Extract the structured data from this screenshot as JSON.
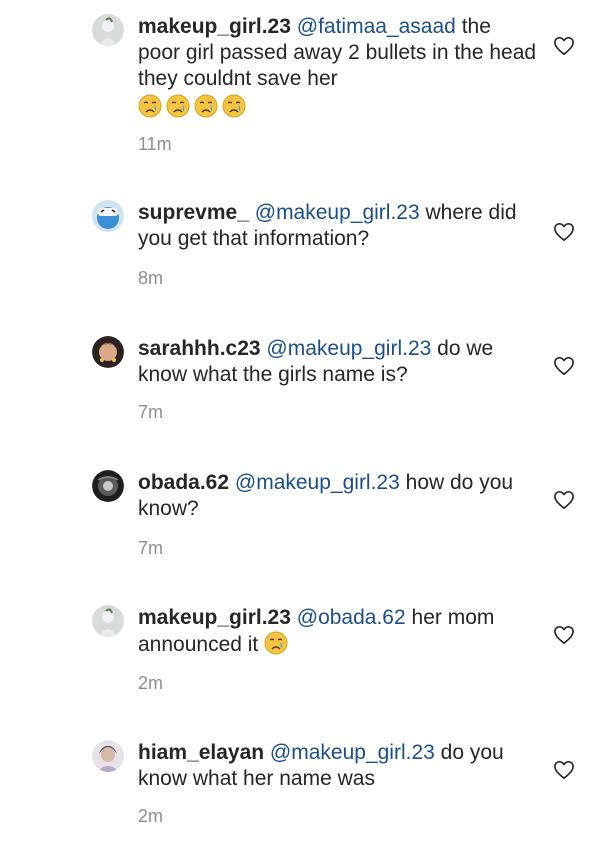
{
  "comments": [
    {
      "username": "makeup_girl.23",
      "mention": "@fatimaa_asaad",
      "text": "the poor girl passed away 2 bullets in the head they couldnt save her",
      "emoji": [
        "crying-face",
        "crying-face",
        "crying-face",
        "crying-face"
      ],
      "time": "11m"
    },
    {
      "username": "suprevme_",
      "mention": "@makeup_girl.23",
      "text": "where did you get that information?",
      "time": "8m"
    },
    {
      "username": "sarahhh.c23",
      "mention": "@makeup_girl.23",
      "text": "do we know what the girls name is?",
      "time": "7m"
    },
    {
      "username": "obada.62",
      "mention": "@makeup_girl.23",
      "text": "how do you know?",
      "time": "7m"
    },
    {
      "username": "makeup_girl.23",
      "mention": "@obada.62",
      "text": "her mom announced it",
      "emoji": [
        "crying-face"
      ],
      "time": "2m"
    },
    {
      "username": "hiam_elayan",
      "mention": "@makeup_girl.23",
      "text": "do you know what her name was",
      "time": "2m"
    }
  ],
  "colors": {
    "text": "#262626",
    "mention": "#1a4f8a",
    "timestamp": "#8e8e8e",
    "emoji_face": "#f5c542"
  },
  "icons": {
    "like": "heart-outline-icon",
    "emoji": "crying-face-icon"
  }
}
